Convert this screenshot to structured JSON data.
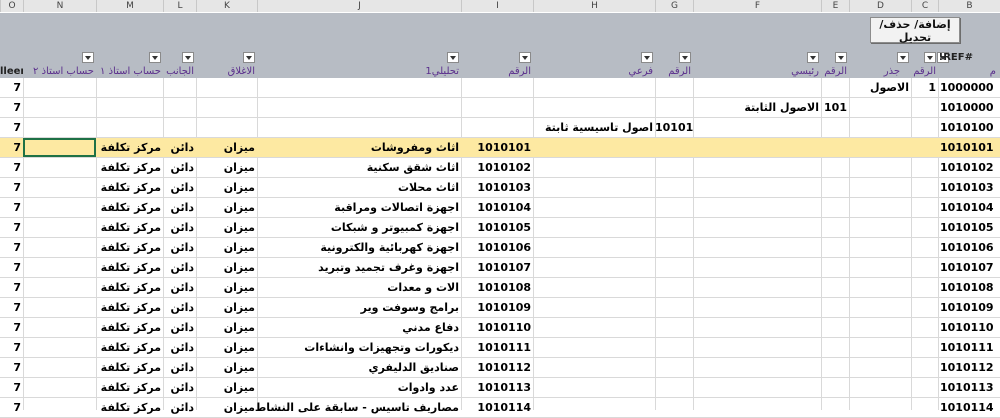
{
  "toolbar": {
    "edit_button_label": "إضافة/ حذف/ تحديل"
  },
  "column_letters": [
    "O",
    "N",
    "M",
    "L",
    "K",
    "J",
    "I",
    "H",
    "G",
    "F",
    "E",
    "D",
    "C",
    "B"
  ],
  "headers": {
    "o": "lleen",
    "n": "حساب استاذ ٢",
    "m": "حساب استاذ ١",
    "l": "الجانب",
    "k": "الاغلاق",
    "j": "تحليلي1",
    "i": "الرقم",
    "h": "فرعي",
    "g": "الرقم",
    "f": "رئيسي",
    "e": "الرقم",
    "d": "جذر",
    "c": "الرقم",
    "b": "#REF!",
    "a": "م"
  },
  "rows": [
    {
      "o": "7",
      "n": "",
      "m": "",
      "l": "",
      "k": "",
      "j": "",
      "i": "",
      "h": "",
      "g": "",
      "f": "",
      "e": "",
      "d": "الاصول",
      "c": "1",
      "b": "1000000"
    },
    {
      "o": "7",
      "n": "",
      "m": "",
      "l": "",
      "k": "",
      "j": "",
      "i": "",
      "h": "",
      "g": "",
      "f": "الاصول الثابتة",
      "e": "101",
      "d": "",
      "c": "",
      "b": "1010000"
    },
    {
      "o": "7",
      "n": "",
      "m": "",
      "l": "",
      "k": "",
      "j": "",
      "i": "",
      "h": "اصول تاسيسية ثابتة",
      "g": "10101",
      "f": "",
      "e": "",
      "d": "",
      "c": "",
      "b": "1010100"
    },
    {
      "o": "7",
      "n": "",
      "m": "مركز تكلفة",
      "l": "دائن",
      "k": "ميزان",
      "j": "اثاث ومفروشات",
      "i": "1010101",
      "h": "",
      "g": "",
      "f": "",
      "e": "",
      "d": "",
      "c": "",
      "b": "1010101"
    },
    {
      "o": "7",
      "n": "",
      "m": "مركز تكلفة",
      "l": "دائن",
      "k": "ميزان",
      "j": "اثاث شقق سكنية",
      "i": "1010102",
      "h": "",
      "g": "",
      "f": "",
      "e": "",
      "d": "",
      "c": "",
      "b": "1010102"
    },
    {
      "o": "7",
      "n": "",
      "m": "مركز تكلفة",
      "l": "دائن",
      "k": "ميزان",
      "j": "اثاث محلات",
      "i": "1010103",
      "h": "",
      "g": "",
      "f": "",
      "e": "",
      "d": "",
      "c": "",
      "b": "1010103"
    },
    {
      "o": "7",
      "n": "",
      "m": "مركز تكلفة",
      "l": "دائن",
      "k": "ميزان",
      "j": "اجهزة اتصالات ومراقبة",
      "i": "1010104",
      "h": "",
      "g": "",
      "f": "",
      "e": "",
      "d": "",
      "c": "",
      "b": "1010104"
    },
    {
      "o": "7",
      "n": "",
      "m": "مركز تكلفة",
      "l": "دائن",
      "k": "ميزان",
      "j": "اجهزة كمبيوتر و شبكات",
      "i": "1010105",
      "h": "",
      "g": "",
      "f": "",
      "e": "",
      "d": "",
      "c": "",
      "b": "1010105"
    },
    {
      "o": "7",
      "n": "",
      "m": "مركز تكلفة",
      "l": "دائن",
      "k": "ميزان",
      "j": "اجهزة كهربائية والكترونية",
      "i": "1010106",
      "h": "",
      "g": "",
      "f": "",
      "e": "",
      "d": "",
      "c": "",
      "b": "1010106"
    },
    {
      "o": "7",
      "n": "",
      "m": "مركز تكلفة",
      "l": "دائن",
      "k": "ميزان",
      "j": "اجهزة وغرف تجميد وتبريد",
      "i": "1010107",
      "h": "",
      "g": "",
      "f": "",
      "e": "",
      "d": "",
      "c": "",
      "b": "1010107"
    },
    {
      "o": "7",
      "n": "",
      "m": "مركز تكلفة",
      "l": "دائن",
      "k": "ميزان",
      "j": "الات و معدات",
      "i": "1010108",
      "h": "",
      "g": "",
      "f": "",
      "e": "",
      "d": "",
      "c": "",
      "b": "1010108"
    },
    {
      "o": "7",
      "n": "",
      "m": "مركز تكلفة",
      "l": "دائن",
      "k": "ميزان",
      "j": "برامج وسوفت وير",
      "i": "1010109",
      "h": "",
      "g": "",
      "f": "",
      "e": "",
      "d": "",
      "c": "",
      "b": "1010109"
    },
    {
      "o": "7",
      "n": "",
      "m": "مركز تكلفة",
      "l": "دائن",
      "k": "ميزان",
      "j": "دفاع مدني",
      "i": "1010110",
      "h": "",
      "g": "",
      "f": "",
      "e": "",
      "d": "",
      "c": "",
      "b": "1010110"
    },
    {
      "o": "7",
      "n": "",
      "m": "مركز تكلفة",
      "l": "دائن",
      "k": "ميزان",
      "j": "ديكورات وتجهيزات وانشاءات",
      "i": "1010111",
      "h": "",
      "g": "",
      "f": "",
      "e": "",
      "d": "",
      "c": "",
      "b": "1010111"
    },
    {
      "o": "7",
      "n": "",
      "m": "مركز تكلفة",
      "l": "دائن",
      "k": "ميزان",
      "j": "صناديق الدليفري",
      "i": "1010112",
      "h": "",
      "g": "",
      "f": "",
      "e": "",
      "d": "",
      "c": "",
      "b": "1010112"
    },
    {
      "o": "7",
      "n": "",
      "m": "مركز تكلفة",
      "l": "دائن",
      "k": "ميزان",
      "j": "عدد وادوات",
      "i": "1010113",
      "h": "",
      "g": "",
      "f": "",
      "e": "",
      "d": "",
      "c": "",
      "b": "1010113"
    },
    {
      "o": "7",
      "n": "",
      "m": "مركز تكلفة",
      "l": "دائن",
      "k": "ميزان",
      "j": "مصاريف تاسيس - سابقة على النشاط",
      "i": "1010114",
      "h": "",
      "g": "",
      "f": "",
      "e": "",
      "d": "",
      "c": "",
      "b": "1010114"
    }
  ],
  "highlight_row": 3,
  "colors": {
    "header_band": "#b7bcc4",
    "highlight": "#fde9a2",
    "header_text": "#5a2e8c",
    "selection": "#1e7145"
  }
}
